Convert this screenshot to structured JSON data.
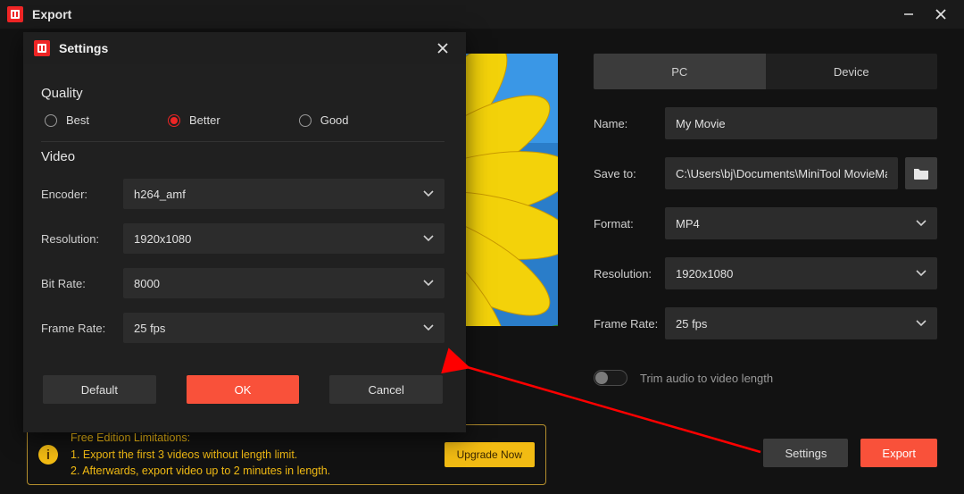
{
  "titlebar": {
    "title": "Export"
  },
  "tabs": {
    "pc": "PC",
    "device": "Device"
  },
  "form": {
    "name_label": "Name:",
    "name_value": "My Movie",
    "saveto_label": "Save to:",
    "saveto_value": "C:\\Users\\bj\\Documents\\MiniTool MovieMaker\\outp",
    "format_label": "Format:",
    "format_value": "MP4",
    "resolution_label": "Resolution:",
    "resolution_value": "1920x1080",
    "framerate_label": "Frame Rate:",
    "framerate_value": "25 fps",
    "trim_label": "Trim audio to video length"
  },
  "notice": {
    "title": "Free Edition Limitations:",
    "line1": "1. Export the first 3 videos without length limit.",
    "line2": "2. Afterwards, export video up to 2 minutes in length.",
    "upgrade": "Upgrade Now"
  },
  "bottom": {
    "settings": "Settings",
    "export": "Export"
  },
  "modal": {
    "title": "Settings",
    "quality_title": "Quality",
    "best": "Best",
    "better": "Better",
    "good": "Good",
    "video_title": "Video",
    "encoder_label": "Encoder:",
    "encoder_value": "h264_amf",
    "resolution_label": "Resolution:",
    "resolution_value": "1920x1080",
    "bitrate_label": "Bit Rate:",
    "bitrate_value": "8000",
    "framerate_label": "Frame Rate:",
    "framerate_value": "25 fps",
    "default_btn": "Default",
    "ok_btn": "OK",
    "cancel_btn": "Cancel"
  }
}
